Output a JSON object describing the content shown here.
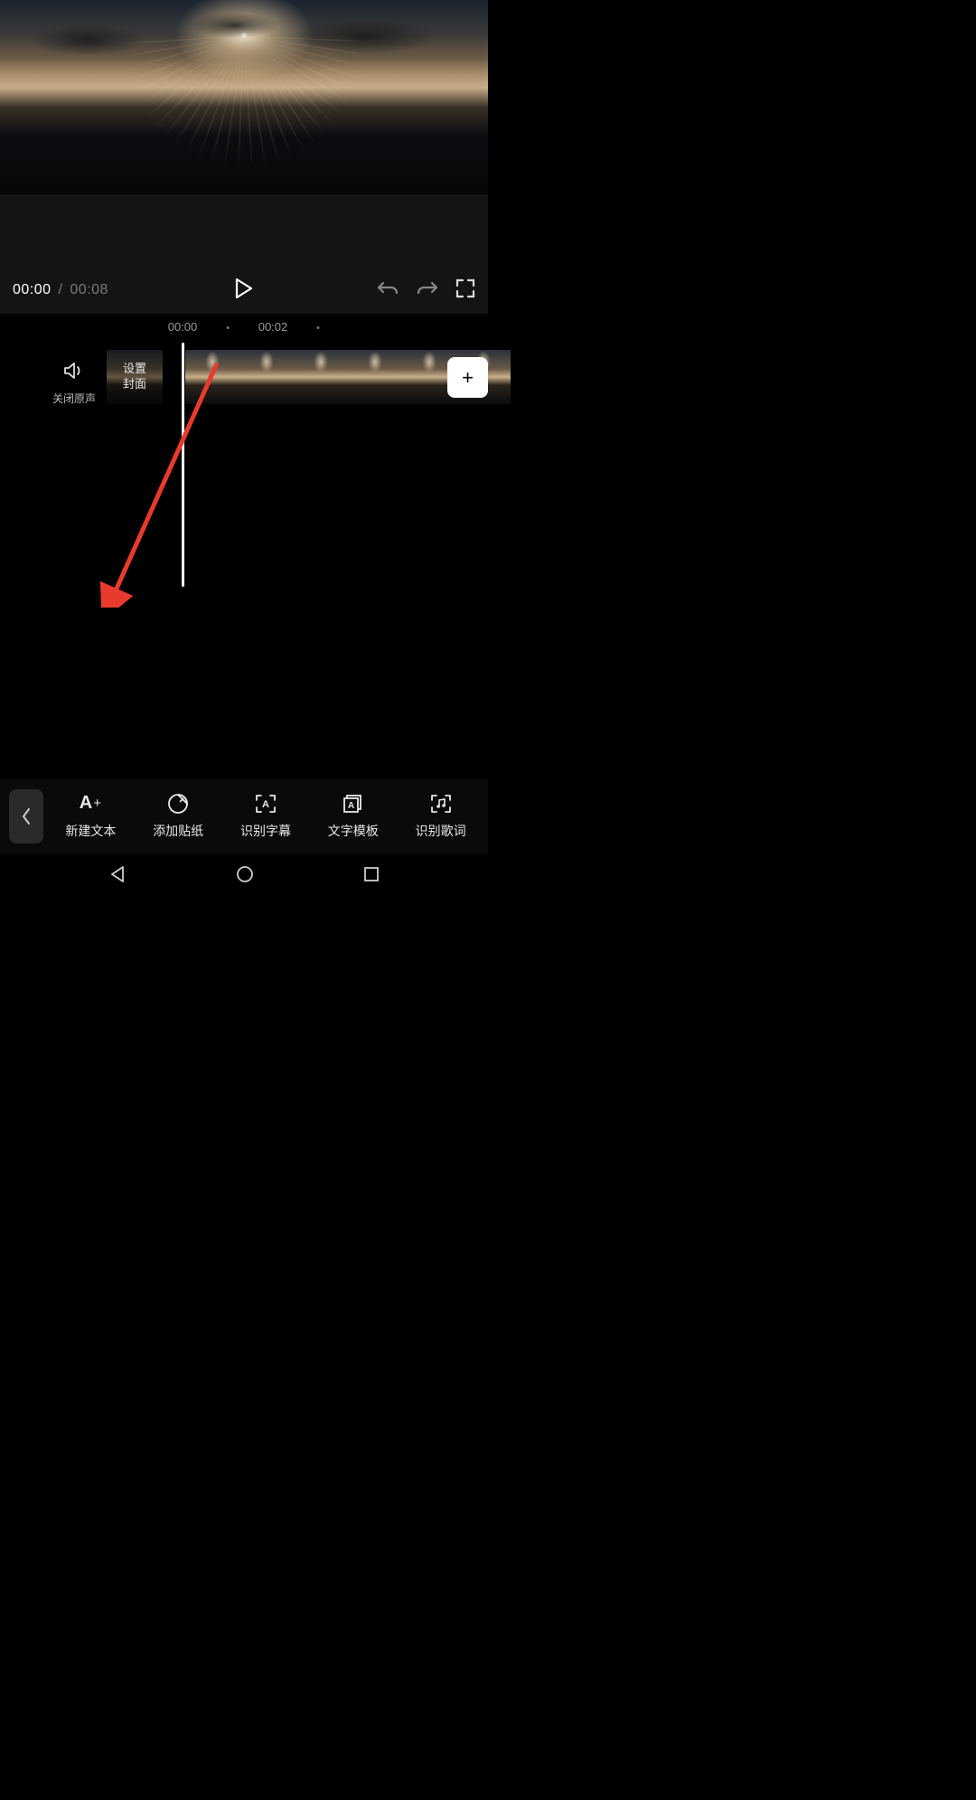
{
  "transport": {
    "current_time": "00:00",
    "separator": "/",
    "duration": "00:08"
  },
  "timeline": {
    "ticks": [
      "00:00",
      "00:02"
    ]
  },
  "audio": {
    "label": "关闭原声"
  },
  "cover": {
    "line1": "设置",
    "line2": "封面"
  },
  "add_button": "+",
  "toolbar": {
    "back": "‹",
    "items": [
      {
        "label": "新建文本",
        "icon": "text-add-icon"
      },
      {
        "label": "添加贴纸",
        "icon": "sticker-icon"
      },
      {
        "label": "识别字幕",
        "icon": "recognize-subtitle-icon"
      },
      {
        "label": "文字模板",
        "icon": "text-template-icon"
      },
      {
        "label": "识别歌词",
        "icon": "recognize-lyrics-icon"
      }
    ]
  },
  "annotation": {
    "arrow_color": "#E83A2D"
  }
}
